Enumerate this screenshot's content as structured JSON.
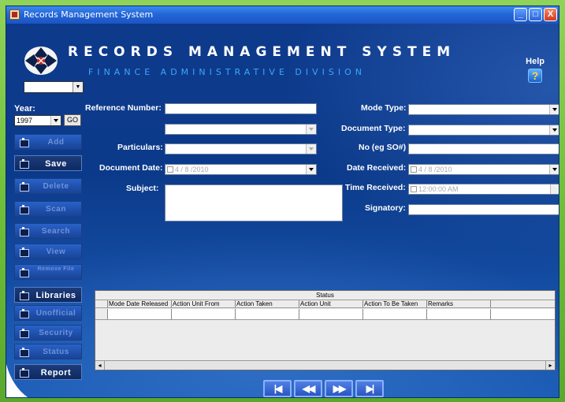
{
  "window": {
    "title": "Records Management System",
    "min_label": "_",
    "max_label": "□",
    "close_label": "X"
  },
  "header": {
    "title": "RECORDS MANAGEMENT SYSTEM",
    "subtitle": "FINANCE ADMINISTRATIVE DIVISION",
    "help_label": "Help",
    "help_glyph": "?"
  },
  "left": {
    "year_label": "Year:",
    "year_value": "1997",
    "go_label": "GO",
    "buttons": [
      {
        "label": "Add",
        "state": "disabled"
      },
      {
        "label": "Save",
        "state": "active"
      },
      {
        "label": "Delete",
        "state": "disabled"
      },
      {
        "label": "Scan",
        "state": "disabled"
      },
      {
        "label": "Search",
        "state": "disabled"
      },
      {
        "label": "View",
        "state": "disabled"
      },
      {
        "label": "Remove File",
        "state": "disabled"
      },
      {
        "label": "Libraries",
        "state": "active"
      },
      {
        "label": "Unofficial",
        "state": "disabled"
      },
      {
        "label": "Security",
        "state": "disabled"
      },
      {
        "label": "Status",
        "state": "disabled"
      },
      {
        "label": "Report",
        "state": "active"
      }
    ]
  },
  "form": {
    "reference_label": "Reference Number:",
    "particulars_label": "Particulars:",
    "document_date_label": "Document Date:",
    "document_date_value": "4 / 8 /2010",
    "subject_label": "Subject:",
    "mode_type_label": "Mode Type:",
    "document_type_label": "Document Type:",
    "no_label": "No (eg SO#)",
    "date_received_label": "Date Received:",
    "date_received_value": "4 / 8 /2010",
    "time_received_label": "Time Received:",
    "time_received_value": "12:00:00 AM",
    "signatory_label": "Signatory:"
  },
  "status_grid": {
    "caption": "Status",
    "columns": [
      "Mode Date Released",
      "Action Unit From",
      "Action Taken",
      "Action Unit",
      "Action To Be Taken",
      "Remarks"
    ],
    "scroll_left": "◂",
    "scroll_right": "▸"
  },
  "nav": {
    "first": "|◀",
    "prev": "◀◀",
    "next": "▶▶",
    "last": "▶|"
  }
}
